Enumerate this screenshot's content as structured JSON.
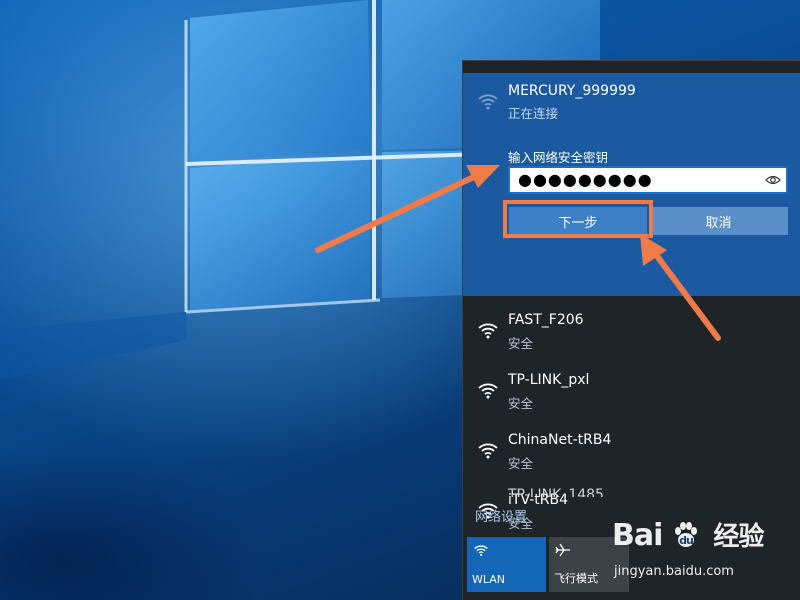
{
  "active_network": {
    "name": "MERCURY_999999",
    "status": "正在连接",
    "key_label": "输入网络安全密钥",
    "password_masked": "●●●●●●●●●",
    "next_label": "下一步",
    "cancel_label": "取消"
  },
  "networks": [
    {
      "name": "FAST_F206",
      "status": "安全"
    },
    {
      "name": "TP-LINK_pxl",
      "status": "安全"
    },
    {
      "name": "ChinaNet-tRB4",
      "status": "安全"
    },
    {
      "name": "iTV-tRB4",
      "status": "安全"
    },
    {
      "name": "TP-LINK_1485",
      "status": ""
    }
  ],
  "network_settings_label": "网络设置",
  "tiles": {
    "wlan_label": "WLAN",
    "airplane_label": "飞行模式"
  },
  "watermark": {
    "brand": "Bai",
    "brand_cn": "经验",
    "url": "jingyan.baidu.com"
  },
  "colors": {
    "annotation": "#ef7a4a",
    "active_bg": "#1b5aa1",
    "flyout_bg": "#1f2429"
  },
  "icons": {
    "wifi": "wifi-icon",
    "eye": "eye-icon",
    "airplane": "airplane-icon"
  }
}
